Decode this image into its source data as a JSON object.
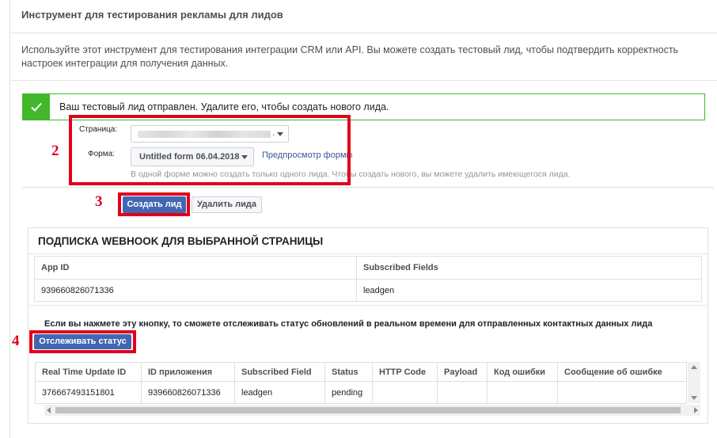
{
  "header": {
    "title": "Инструмент для тестирования рекламы для лидов"
  },
  "description": "Используйте этот инструмент для тестирования интеграции CRM или API. Вы можете создать тестовый лид, чтобы подтвердить корректность настроек интеграции для получения данных.",
  "success": {
    "message": "Ваш тестовый лид отправлен. Удалите его, чтобы создать нового лида."
  },
  "form": {
    "page_label": "Страница:",
    "page_dot": ".",
    "form_label": "Форма:",
    "form_value": "Untitled form 06.04.2018",
    "preview_link": "Предпросмотр формы",
    "hint": "В одной форме можно создать только одного лида. Чтобы создать нового, вы можете удалить имеющегося лида."
  },
  "steps": {
    "s2": "2",
    "s3": "3",
    "s4": "4"
  },
  "buttons": {
    "create_lead": "Создать лид",
    "delete_lead": "Удалить лида",
    "track_status": "Отслеживать статус"
  },
  "webhook": {
    "title": "ПОДПИСКА WEBHOOK ДЛЯ ВЫБРАННОЙ СТРАНИЦЫ",
    "columns": [
      "App ID",
      "Subscribed Fields"
    ],
    "rows": [
      [
        "939660826071336",
        "leadgen"
      ]
    ]
  },
  "tracking": {
    "note": "Если вы нажмете эту кнопку, то сможете отслеживать статус обновлений в реальном времени для отправленных контактных данных лида",
    "columns": [
      "Real Time Update ID",
      "ID приложения",
      "Subscribed Field",
      "Status",
      "HTTP Code",
      "Payload",
      "Код ошибки",
      "Сообщение об ошибке"
    ],
    "rows": [
      [
        "376667493151801",
        "939660826071336",
        "leadgen",
        "pending",
        "",
        "",
        "",
        ""
      ]
    ]
  },
  "colors": {
    "accent": "#4267b2",
    "success": "#42b72a",
    "highlight": "#e0001b"
  }
}
